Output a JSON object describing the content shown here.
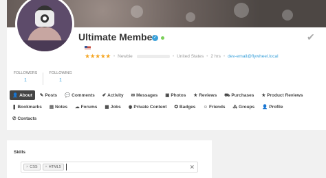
{
  "profile": {
    "name": "Ultimate Member",
    "role": "Newbie",
    "country": "United States",
    "last_seen": "2 hrs",
    "email": "dev-email@flywheel.local",
    "rating_stars": "★★★★★",
    "verified_glyph": "✓",
    "check_glyph": "✔",
    "online_color": "#7ACF58",
    "accent_color": "#3ba1da"
  },
  "stats": [
    {
      "label": "FOLLOWERS",
      "value": "1"
    },
    {
      "label": "FOLLOWING",
      "value": "1"
    }
  ],
  "tabs": [
    {
      "label": "About",
      "icon": "user-icon",
      "glyph": "👤"
    },
    {
      "label": "Posts",
      "icon": "pencil-icon",
      "glyph": "✎"
    },
    {
      "label": "Comments",
      "icon": "comment-icon",
      "glyph": "💬"
    },
    {
      "label": "Activity",
      "icon": "edit-icon",
      "glyph": "✐"
    },
    {
      "label": "Messages",
      "icon": "envelope-icon",
      "glyph": "✉"
    },
    {
      "label": "Photos",
      "icon": "photo-icon",
      "glyph": "▣"
    },
    {
      "label": "Reviews",
      "icon": "star-icon",
      "glyph": "★"
    },
    {
      "label": "Purchases",
      "icon": "cart-icon",
      "glyph": "⛟"
    },
    {
      "label": "Product Reviews",
      "icon": "star-icon",
      "glyph": "★"
    },
    {
      "label": "Bookmarks",
      "icon": "bookmark-icon",
      "glyph": "❚"
    },
    {
      "label": "Notes",
      "icon": "note-icon",
      "glyph": "▤"
    },
    {
      "label": "Forums",
      "icon": "chat-icon",
      "glyph": "☁"
    },
    {
      "label": "Jobs",
      "icon": "calendar-icon",
      "glyph": "▦"
    },
    {
      "label": "Private Content",
      "icon": "eye-icon",
      "glyph": "◉"
    },
    {
      "label": "Badges",
      "icon": "badge-icon",
      "glyph": "✪"
    },
    {
      "label": "Friends",
      "icon": "friends-icon",
      "glyph": "☺"
    },
    {
      "label": "Groups",
      "icon": "groups-icon",
      "glyph": "⁂"
    },
    {
      "label": "Profile",
      "icon": "user-icon",
      "glyph": "👤"
    },
    {
      "label": "Contacts",
      "icon": "phone-icon",
      "glyph": "✆"
    }
  ],
  "skills": {
    "label": "Skills",
    "tags": [
      "CSS",
      "HTML5"
    ],
    "remove_glyph": "×",
    "clear_glyph": "✕"
  }
}
